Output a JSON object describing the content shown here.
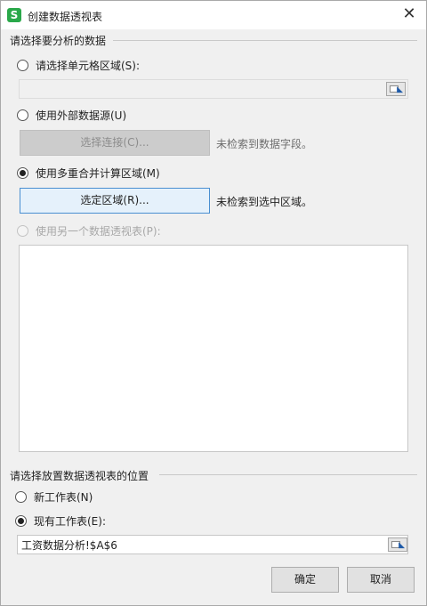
{
  "window": {
    "title": "创建数据透视表",
    "icon": "S",
    "close": "✕"
  },
  "source_group": {
    "title": "请选择要分析的数据",
    "options": [
      {
        "label": "请选择单元格区域(S):",
        "checked": false,
        "disabled": false
      },
      {
        "label": "使用外部数据源(U)",
        "checked": false,
        "disabled": false
      },
      {
        "label": "使用多重合并计算区域(M)",
        "checked": true,
        "disabled": false
      },
      {
        "label": "使用另一个数据透视表(P):",
        "checked": false,
        "disabled": true
      }
    ],
    "select_connection_button": "选择连接(C)...",
    "no_fields_text": "未检索到数据字段。",
    "select_range_button": "选定区域(R)...",
    "no_range_text": "未检索到选中区域。"
  },
  "location_group": {
    "title": "请选择放置数据透视表的位置",
    "options": [
      {
        "label": "新工作表(N)",
        "checked": false
      },
      {
        "label": "现有工作表(E):",
        "checked": true
      }
    ],
    "location_value": "工资数据分析!$A$6"
  },
  "footer": {
    "ok": "确定",
    "cancel": "取消"
  },
  "colors": {
    "app_icon": "#2aa84a",
    "focus_border": "#4a8fd1"
  }
}
